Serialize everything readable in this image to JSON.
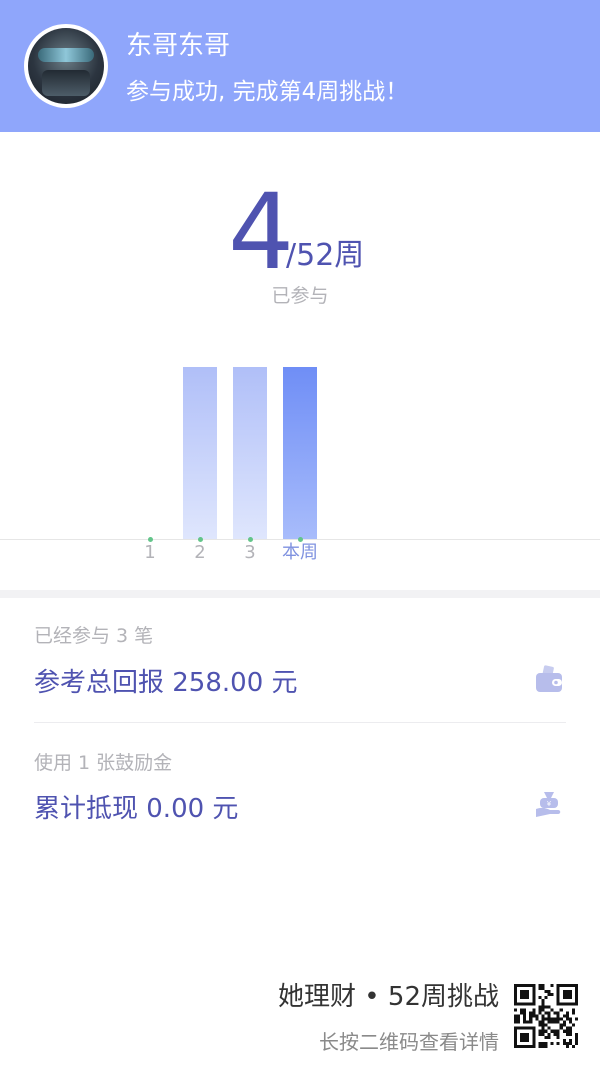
{
  "header": {
    "user_name": "东哥东哥",
    "message": "参与成功, 完成第4周挑战！",
    "background_color": "#8fa6fb"
  },
  "progress": {
    "completed_weeks": "4",
    "total_weeks": "/52周",
    "label": "已参与"
  },
  "chart_data": {
    "type": "bar",
    "categories": [
      "1",
      "2",
      "3",
      "本周"
    ],
    "values": [
      0,
      1,
      1,
      1
    ],
    "highlight_index": 3,
    "colors": {
      "bar": "#b0bff8",
      "current": "#6f8ef6",
      "dot": "#63c58a"
    }
  },
  "stats": [
    {
      "label": "已经参与 3 笔",
      "value": "参考总回报 258.00 元",
      "icon": "wallet-icon"
    },
    {
      "label": "使用 1 张鼓励金",
      "value": "累计抵现 0.00 元",
      "icon": "cash-hand-icon"
    }
  ],
  "footer": {
    "brand": "她理财 • 52周挑战",
    "hint": "长按二维码查看详情",
    "qr_icon": "qr-code-icon"
  }
}
